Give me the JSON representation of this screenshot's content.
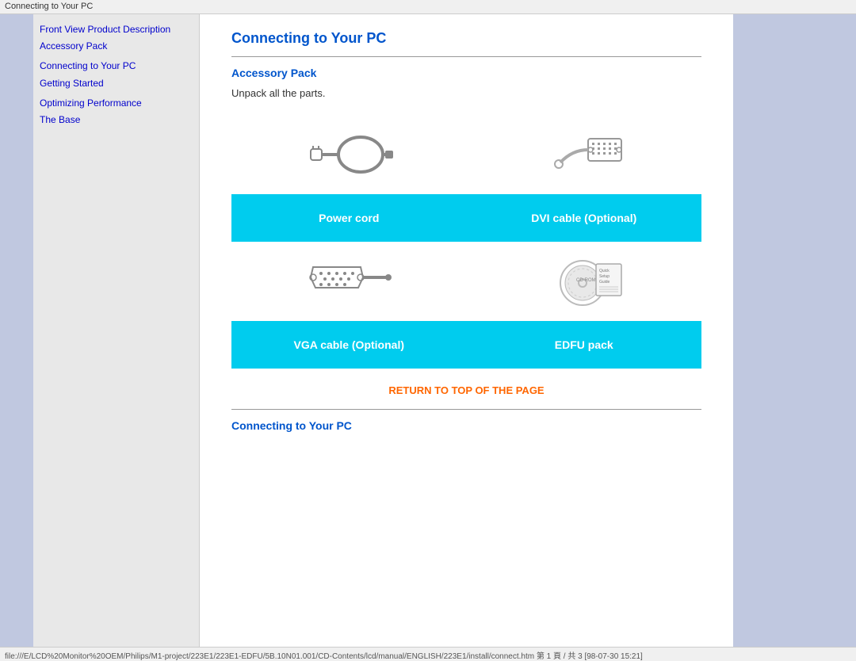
{
  "titleBar": "Connecting to Your PC",
  "sidebar": {
    "items": [
      {
        "label": "Front View Product Description",
        "href": "#"
      },
      {
        "label": "Accessory Pack",
        "href": "#"
      },
      {
        "label": "Connecting to Your PC",
        "href": "#"
      },
      {
        "label": "Getting Started",
        "href": "#"
      },
      {
        "label": "Optimizing Performance",
        "href": "#"
      },
      {
        "label": "The Base",
        "href": "#"
      }
    ]
  },
  "main": {
    "pageTitle": "Connecting to Your PC",
    "accessorySection": {
      "title": "Accessory Pack",
      "introText": "Unpack all the parts.",
      "products": [
        {
          "label": "Power cord",
          "iconType": "power-cord"
        },
        {
          "label": "DVI cable (Optional)",
          "iconType": "dvi-cable"
        },
        {
          "label": "VGA cable (Optional)",
          "iconType": "vga-cable"
        },
        {
          "label": "EDFU pack",
          "iconType": "edfu-pack"
        }
      ]
    },
    "returnLink": "RETURN TO TOP OF THE PAGE",
    "connectingSection": {
      "title": "Connecting to Your PC"
    }
  },
  "statusBar": "file:///E/LCD%20Monitor%20OEM/Philips/M1-project/223E1/223E1-EDFU/5B.10N01.001/CD-Contents/lcd/manual/ENGLISH/223E1/install/connect.htm 第 1 頁 / 共 3 [98-07-30 15:21]"
}
